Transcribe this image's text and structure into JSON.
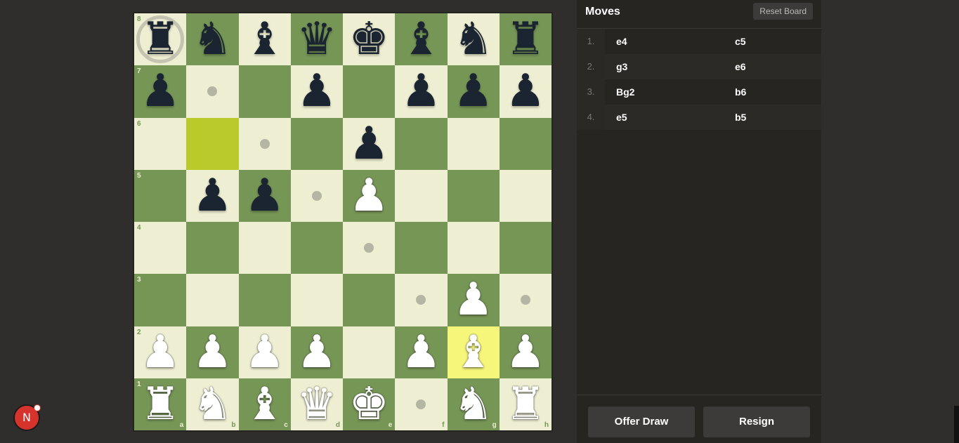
{
  "board": {
    "ranks": [
      "8",
      "7",
      "6",
      "5",
      "4",
      "3",
      "2",
      "1"
    ],
    "files": [
      "a",
      "b",
      "c",
      "d",
      "e",
      "f",
      "g",
      "h"
    ],
    "position": [
      [
        "bR",
        "bN",
        "bB",
        "bQ",
        "bK",
        "bB",
        "bN",
        "bR"
      ],
      [
        "bP",
        "",
        "",
        "bP",
        "",
        "bP",
        "bP",
        "bP"
      ],
      [
        "",
        "",
        "",
        "",
        "bP",
        "",
        "",
        ""
      ],
      [
        "",
        "bP",
        "bP",
        "",
        "wP",
        "",
        "",
        ""
      ],
      [
        "",
        "",
        "",
        "",
        "",
        "",
        "",
        ""
      ],
      [
        "",
        "",
        "",
        "",
        "",
        "",
        "wP",
        ""
      ],
      [
        "wP",
        "wP",
        "wP",
        "wP",
        "",
        "wP",
        "wB",
        "wP"
      ],
      [
        "wR",
        "wN",
        "wB",
        "wQ",
        "wK",
        "",
        "wN",
        "wR"
      ]
    ],
    "highlight_squares": [
      "b6",
      "g2"
    ],
    "move_hint_squares": [
      "b7",
      "c6",
      "d5",
      "e4",
      "f3",
      "h3",
      "f1"
    ],
    "capture_hint_squares": [
      "a8"
    ],
    "colors": {
      "light": "#eeeed2",
      "dark": "#769656",
      "highlight_light": "#f6f67a",
      "highlight_dark": "#baca2b"
    }
  },
  "panel": {
    "title": "Moves",
    "reset_label": "Reset Board",
    "moves": [
      {
        "num": "1.",
        "white": "e4",
        "black": "c5"
      },
      {
        "num": "2.",
        "white": "g3",
        "black": "e6"
      },
      {
        "num": "3.",
        "white": "Bg2",
        "black": "b6"
      },
      {
        "num": "4.",
        "white": "e5",
        "black": "b5"
      }
    ],
    "offer_draw_label": "Offer Draw",
    "resign_label": "Resign"
  },
  "avatar": {
    "letter": "N",
    "icon": "profile-avatar-icon"
  }
}
